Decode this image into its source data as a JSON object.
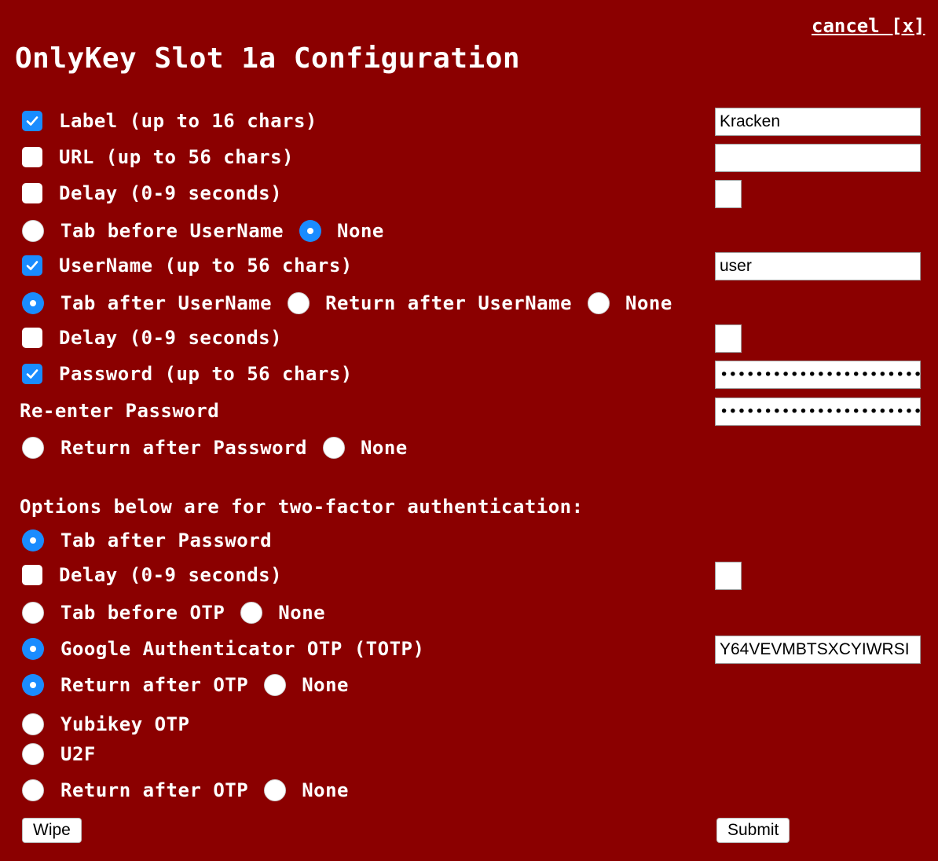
{
  "header": {
    "cancel_label": "cancel [x]",
    "title": "OnlyKey Slot 1a Configuration"
  },
  "fields": {
    "label": {
      "text": "Label (up to 16 chars)",
      "checked": true,
      "value": "Kracken"
    },
    "url": {
      "text": "URL (up to 56 chars)",
      "checked": false,
      "value": ""
    },
    "delay1": {
      "text": "Delay (0-9 seconds)",
      "checked": false,
      "value": ""
    },
    "tab_before_username": {
      "text": "Tab before UserName",
      "none_label": "None",
      "selected": "None"
    },
    "username": {
      "text": "UserName (up to 56 chars)",
      "checked": true,
      "value": "user"
    },
    "after_username": {
      "tab_label": "Tab after UserName",
      "return_label": "Return after UserName",
      "none_label": "None",
      "selected": "Tab after UserName"
    },
    "delay2": {
      "text": "Delay (0-9 seconds)",
      "checked": false,
      "value": ""
    },
    "password": {
      "text": "Password (up to 56 chars)",
      "checked": true,
      "masked": "••••••••••••••••••••••••"
    },
    "reenter_password": {
      "text": "Re-enter Password",
      "masked": "••••••••••••••••••••••••"
    },
    "after_password": {
      "return_label": "Return after Password",
      "none_label": "None",
      "selected": "None"
    }
  },
  "twofactor": {
    "heading": "Options below are for two-factor authentication:",
    "tab_after_password": {
      "text": "Tab after Password",
      "selected": true
    },
    "delay3": {
      "text": "Delay (0-9 seconds)",
      "checked": false,
      "value": ""
    },
    "tab_before_otp": {
      "text": "Tab before OTP",
      "none_label": "None",
      "selected": "None"
    },
    "google_totp": {
      "text": "Google Authenticator OTP (TOTP)",
      "selected": true,
      "value": "Y64VEVMBTSXCYIWRSI"
    },
    "return_after_otp_1": {
      "text": "Return after OTP",
      "none_label": "None",
      "selected": "Return after OTP"
    },
    "yubikey": {
      "text": "Yubikey OTP",
      "selected": false
    },
    "u2f": {
      "text": "U2F",
      "selected": false
    },
    "return_after_otp_2": {
      "text": "Return after OTP",
      "none_label": "None",
      "selected": "none"
    }
  },
  "buttons": {
    "wipe_label": "Wipe",
    "submit_label": "Submit"
  },
  "colors": {
    "background": "#8b0000",
    "accent": "#1a8cff"
  }
}
